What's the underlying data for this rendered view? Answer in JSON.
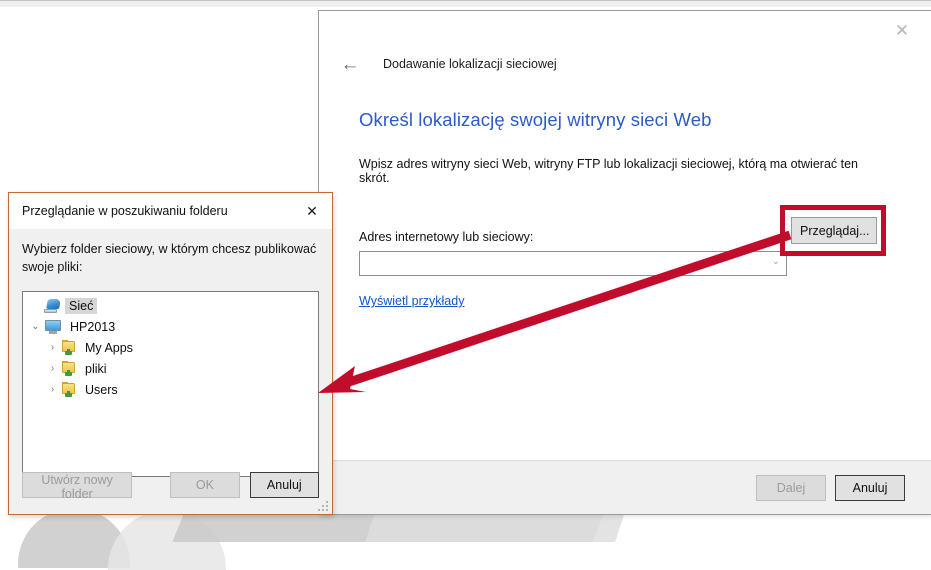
{
  "wizard": {
    "breadcrumb": "Dodawanie lokalizacji sieciowej",
    "heading": "Określ lokalizację swojej witryny sieci Web",
    "subtext": "Wpisz adres witryny sieci Web, witryny FTP lub lokalizacji sieciowej, którą ma otwierać ten skrót.",
    "address_label": "Adres internetowy lub sieciowy:",
    "address_value": "",
    "address_placeholder": "",
    "browse_label": "Przeglądaj...",
    "examples_link": "Wyświetl przykłady",
    "next_label": "Dalej",
    "cancel_label": "Anuluj",
    "close_icon": "✕",
    "back_icon": "←",
    "chevron_icon": "⌄"
  },
  "folder_dialog": {
    "title": "Przeglądanie w poszukiwaniu folderu",
    "instruction": "Wybierz folder sieciowy, w którym chcesz publikować swoje pliki:",
    "close_icon": "✕",
    "tree": [
      {
        "label": "Sieć",
        "icon": "network-icon",
        "level": 1,
        "twisty": "",
        "selected": true
      },
      {
        "label": "HP2013",
        "icon": "monitor-icon",
        "level": 2,
        "twisty": "⌄",
        "selected": false
      },
      {
        "label": "My Apps",
        "icon": "folder-icon",
        "level": 3,
        "twisty": "›",
        "selected": false
      },
      {
        "label": "pliki",
        "icon": "folder-icon",
        "level": 3,
        "twisty": "›",
        "selected": false
      },
      {
        "label": "Users",
        "icon": "folder-icon",
        "level": 3,
        "twisty": "›",
        "selected": false
      }
    ],
    "new_folder_label": "Utwórz nowy folder",
    "ok_label": "OK",
    "cancel_label": "Anuluj"
  },
  "annotation": {
    "highlight_color": "#c10d2b",
    "arrow_color": "#c10d2b",
    "description": "red arrow from Przegladaj button to folder dialog"
  }
}
